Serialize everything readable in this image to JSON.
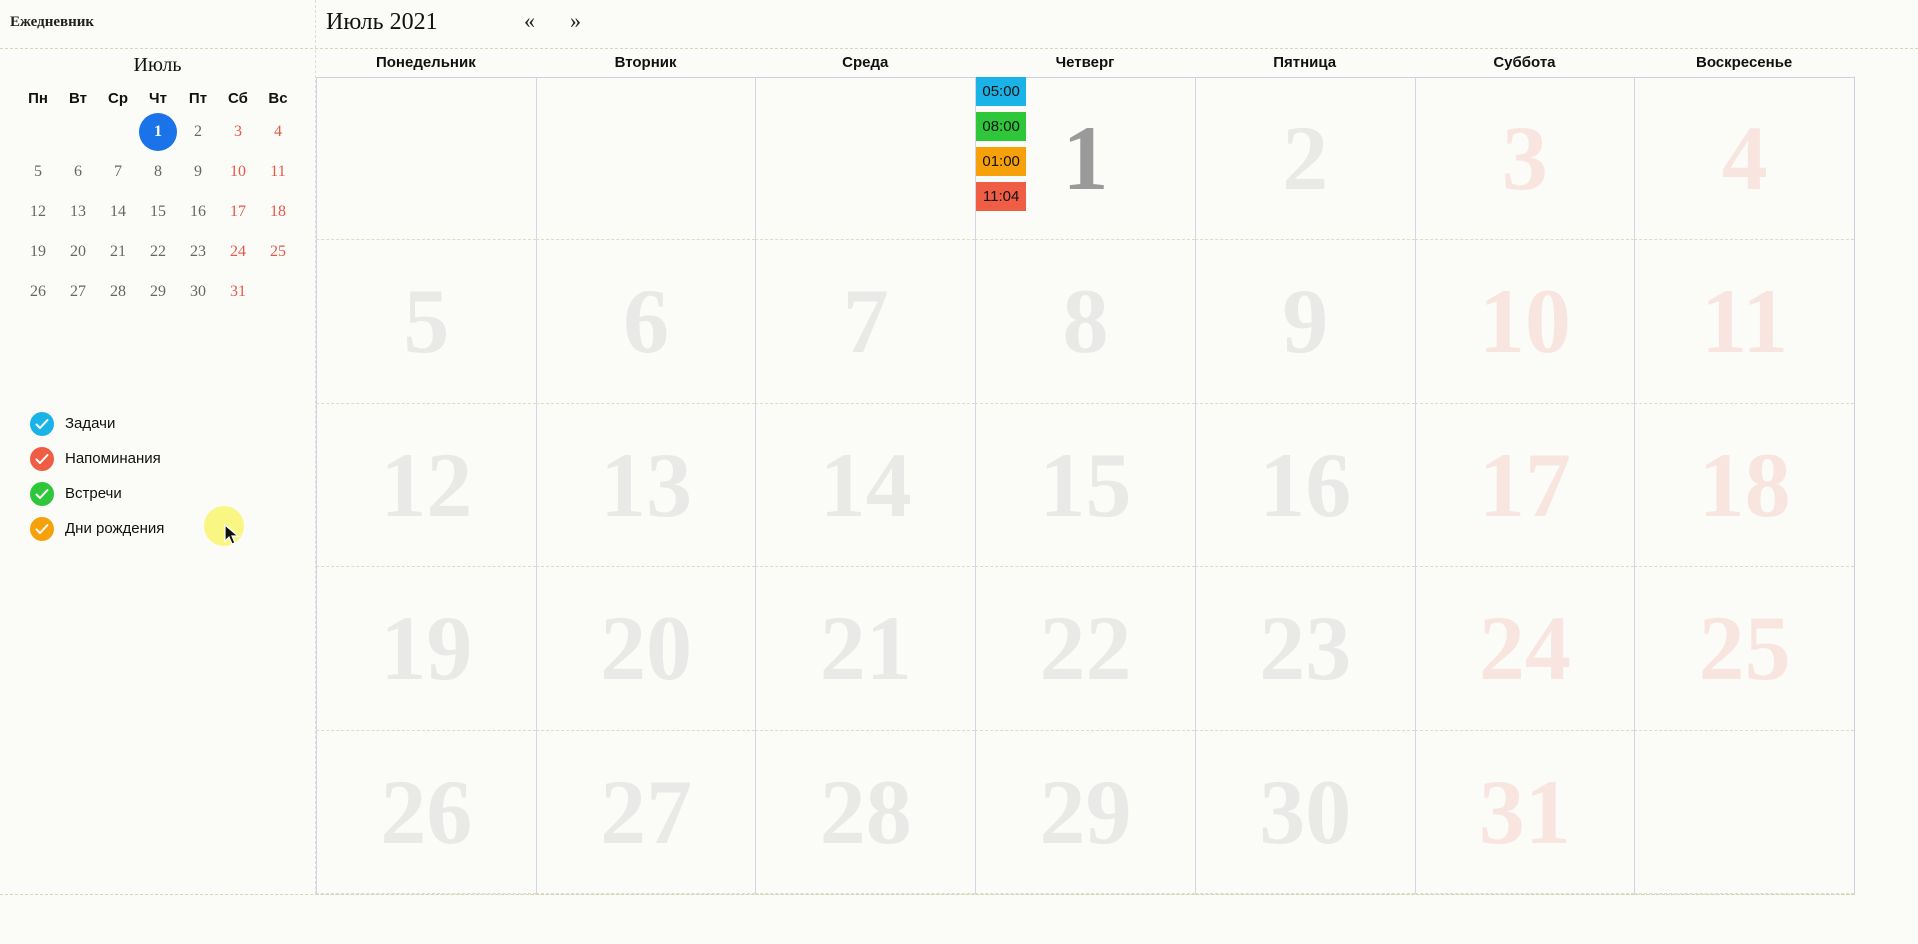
{
  "app": {
    "title": "Ежедневник"
  },
  "header": {
    "month_title": "Июль 2021",
    "prev_icon": "«",
    "next_icon": "»"
  },
  "mini_calendar": {
    "title": "Июль",
    "weekdays": [
      "Пн",
      "Вт",
      "Ср",
      "Чт",
      "Пт",
      "Сб",
      "Вс"
    ],
    "lead_blanks": 3,
    "days": 31,
    "today": 1
  },
  "legend": {
    "items": [
      {
        "label": "Задачи",
        "color": "#1ab3e8"
      },
      {
        "label": "Напоминания",
        "color": "#ef5d45"
      },
      {
        "label": "Встречи",
        "color": "#2ec73a"
      },
      {
        "label": "Дни рождения",
        "color": "#f6a10a"
      }
    ]
  },
  "weekdays_full": [
    "Понедельник",
    "Вторник",
    "Среда",
    "Четверг",
    "Пятница",
    "Суббота",
    "Воскресенье"
  ],
  "month_grid": {
    "lead_blanks": 3,
    "days": 31,
    "today": 1
  },
  "events": {
    "1": [
      {
        "time": "05:00",
        "color": "#1ab3e8"
      },
      {
        "time": "08:00",
        "color": "#2ec73a"
      },
      {
        "time": "01:00",
        "color": "#f6a10a"
      },
      {
        "time": "11:04",
        "color": "#ef5d45"
      }
    ]
  }
}
